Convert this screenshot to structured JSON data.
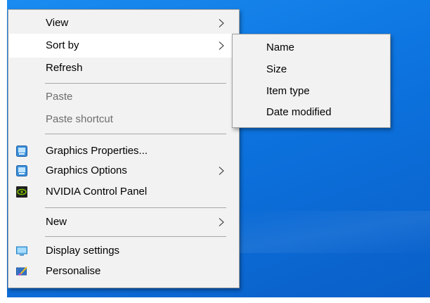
{
  "context_menu": {
    "items": [
      {
        "label": "View",
        "has_submenu": true
      },
      {
        "label": "Sort by",
        "has_submenu": true,
        "highlighted": true
      },
      {
        "label": "Refresh"
      },
      {
        "label": "Paste",
        "disabled": true
      },
      {
        "label": "Paste shortcut",
        "disabled": true
      },
      {
        "label": "Graphics Properties...",
        "icon": "intel-graphics-icon"
      },
      {
        "label": "Graphics Options",
        "icon": "intel-graphics-icon",
        "has_submenu": true
      },
      {
        "label": "NVIDIA Control Panel",
        "icon": "nvidia-icon"
      },
      {
        "label": "New",
        "has_submenu": true
      },
      {
        "label": "Display settings",
        "icon": "display-icon"
      },
      {
        "label": "Personalise",
        "icon": "personalise-icon"
      }
    ]
  },
  "sort_by_submenu": {
    "items": [
      {
        "label": "Name"
      },
      {
        "label": "Size"
      },
      {
        "label": "Item type"
      },
      {
        "label": "Date modified"
      }
    ]
  },
  "colors": {
    "menu_background": "#f2f2f2",
    "highlight": "#ffffff",
    "disabled_text": "#6d6d6d",
    "desktop": "#0d74e0",
    "separator": "#a8a8a8"
  }
}
